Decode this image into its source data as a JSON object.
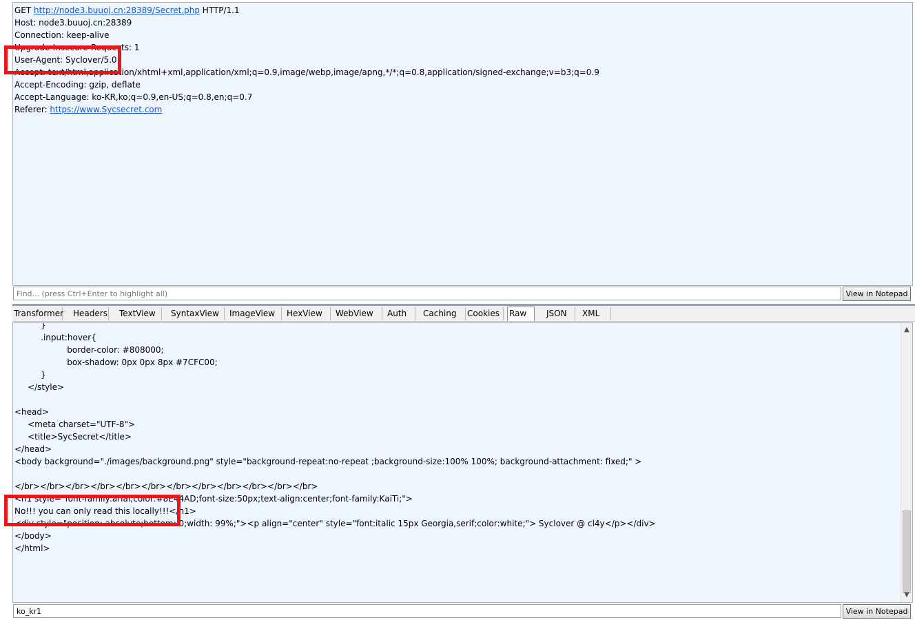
{
  "request": {
    "lines": [
      {
        "pre": "GET ",
        "link": "http://node3.buuoj.cn:28389/Secret.php",
        "post": " HTTP/1.1"
      },
      {
        "pre": "Host: node3.buuoj.cn:28389"
      },
      {
        "pre": "Connection: keep-alive"
      },
      {
        "pre": "Upgrade-Insecure-Requests: 1"
      },
      {
        "pre": "User-Agent: Syclover/5.0"
      },
      {
        "pre": "Accept: text/html,application/xhtml+xml,application/xml;q=0.9,image/webp,image/apng,*/*;q=0.8,application/signed-exchange;v=b3;q=0.9"
      },
      {
        "pre": "Accept-Encoding: gzip, deflate"
      },
      {
        "pre": "Accept-Language: ko-KR,ko;q=0.9,en-US;q=0.8,en;q=0.7"
      },
      {
        "pre": "Referer: ",
        "link": "https://www.Sycsecret.com"
      }
    ],
    "find_placeholder": "Find... (press Ctrl+Enter to highlight all)",
    "view_in_notepad": "View in Notepad"
  },
  "tabs": [
    {
      "label": "Transformer"
    },
    {
      "label": "Headers"
    },
    {
      "label": "TextView"
    },
    {
      "label": "SyntaxView"
    },
    {
      "label": "ImageView"
    },
    {
      "label": "HexView"
    },
    {
      "label": "WebView"
    },
    {
      "label": "Auth"
    },
    {
      "label": "Caching"
    },
    {
      "label": "Cookies"
    },
    {
      "label": "Raw",
      "active": true
    },
    {
      "label": "JSON"
    },
    {
      "label": "XML"
    }
  ],
  "response": {
    "lines": [
      "          }",
      "          .input:hover{",
      "                    border-color: #808000;",
      "                    box-shadow: 0px 0px 8px #7CFC00;",
      "          }",
      "     </style>",
      "",
      "<head>",
      "     <meta charset=\"UTF-8\">",
      "     <title>SycSecret</title>",
      "</head>",
      "<body background=\"./images/background.png\" style=\"background-repeat:no-repeat ;background-size:100% 100%; background-attachment: fixed;\" >",
      "",
      "</br></br></br></br></br></br></br></br></br></br></br></br>",
      "<h1 style=\"font-family:arial;color:#8E44AD;font-size:50px;text-align:center;font-family:KaiTi;\">",
      "No!!! you can only read this locally!!!</h1>",
      "<div style=\"position: absolute;bottom: 0;width: 99%;\"><p align=\"center\" style=\"font:italic 15px Georgia,serif;color:white;\"> Syclover @ cl4y</p></div>",
      "</body>",
      "</html>"
    ],
    "find_value": "ko_kr1",
    "view_in_notepad": "View in Notepad"
  },
  "colors": {
    "pane_bg": "#eef5fd",
    "link": "#1a57c8",
    "annotation": "#e8161b"
  }
}
